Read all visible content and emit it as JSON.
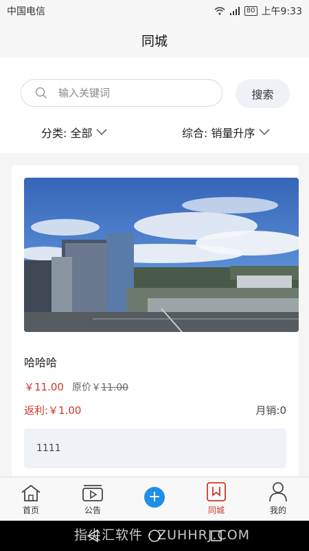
{
  "status_bar": {
    "carrier": "中国电信",
    "battery": "80",
    "time": "上午9:33"
  },
  "header": {
    "title": "同城"
  },
  "search": {
    "placeholder": "输入关键词",
    "button_label": "搜索"
  },
  "filters": {
    "category": "分类: 全部",
    "sort": "综合: 销量升序"
  },
  "product": {
    "title": "哈哈哈",
    "price": "￥11.00",
    "original_price_label": "原价￥",
    "original_price_value": "11.00",
    "rebate": "返利:￥1.00",
    "monthly_sales": "月销:0",
    "description": "1111"
  },
  "tabs": [
    {
      "label": "首页",
      "icon": "home-icon"
    },
    {
      "label": "公告",
      "icon": "video-icon"
    },
    {
      "label": "",
      "icon": "add-icon"
    },
    {
      "label": "同城",
      "icon": "bookmark-icon"
    },
    {
      "label": "我的",
      "icon": "user-icon"
    }
  ],
  "watermark": "指尖汇软件 · ZUHHRJ.COM",
  "colors": {
    "accent_red": "#d0362b",
    "add_button_blue": "#1e8fe8"
  }
}
